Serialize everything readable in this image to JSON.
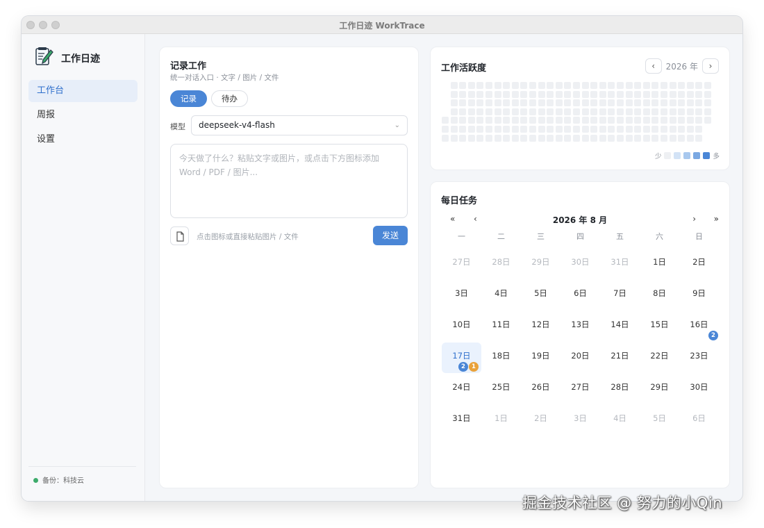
{
  "window": {
    "title": "工作日迹 WorkTrace"
  },
  "sidebar": {
    "app_name": "工作日迹",
    "items": [
      {
        "label": "工作台",
        "active": true
      },
      {
        "label": "周报",
        "active": false
      },
      {
        "label": "设置",
        "active": false
      }
    ],
    "backup_status": "备份：科技云"
  },
  "record": {
    "title": "记录工作",
    "subtitle": "统一对话入口 · 文字 / 图片 / 文件",
    "tabs": [
      {
        "label": "记录",
        "active": true
      },
      {
        "label": "待办",
        "active": false
      }
    ],
    "model_label": "模型",
    "model_value": "deepseek-v4-flash",
    "input_placeholder": "今天做了什么？粘贴文字或图片，或点击下方图标添加 Word / PDF / 图片...",
    "attach_hint": "点击图标或直接粘贴图片 / 文件",
    "send_label": "发送"
  },
  "activity": {
    "title": "工作活跃度",
    "prev": "‹",
    "next": "›",
    "year_label": "2026 年",
    "legend_less": "少",
    "legend_more": "多",
    "legend_colors": [
      "#eef0f3",
      "#d3e3f6",
      "#a8c8ee",
      "#7aa8e2",
      "#4a86d6"
    ]
  },
  "tasks": {
    "title": "每日任务",
    "nav_prev_year": "«",
    "nav_prev_month": "‹",
    "nav_next_month": "›",
    "nav_next_year": "»",
    "month_label": "2026 年 8 月",
    "weekdays": [
      "一",
      "二",
      "三",
      "四",
      "五",
      "六",
      "日"
    ],
    "days": [
      {
        "label": "27日",
        "other": true
      },
      {
        "label": "28日",
        "other": true
      },
      {
        "label": "29日",
        "other": true
      },
      {
        "label": "30日",
        "other": true
      },
      {
        "label": "31日",
        "other": true
      },
      {
        "label": "1日"
      },
      {
        "label": "2日"
      },
      {
        "label": "3日"
      },
      {
        "label": "4日"
      },
      {
        "label": "5日"
      },
      {
        "label": "6日"
      },
      {
        "label": "7日"
      },
      {
        "label": "8日"
      },
      {
        "label": "9日"
      },
      {
        "label": "10日"
      },
      {
        "label": "11日"
      },
      {
        "label": "12日"
      },
      {
        "label": "13日"
      },
      {
        "label": "14日"
      },
      {
        "label": "15日"
      },
      {
        "label": "16日",
        "badges": [
          {
            "count": "2",
            "color": "#4a86d6"
          }
        ]
      },
      {
        "label": "17日",
        "today": true,
        "badges": [
          {
            "count": "2",
            "color": "#4a86d6"
          },
          {
            "count": "1",
            "color": "#e9a23b"
          }
        ]
      },
      {
        "label": "18日"
      },
      {
        "label": "19日"
      },
      {
        "label": "20日"
      },
      {
        "label": "21日"
      },
      {
        "label": "22日"
      },
      {
        "label": "23日"
      },
      {
        "label": "24日"
      },
      {
        "label": "25日"
      },
      {
        "label": "26日"
      },
      {
        "label": "27日"
      },
      {
        "label": "28日"
      },
      {
        "label": "29日"
      },
      {
        "label": "30日"
      },
      {
        "label": "31日"
      },
      {
        "label": "1日",
        "other": true
      },
      {
        "label": "2日",
        "other": true
      },
      {
        "label": "3日",
        "other": true
      },
      {
        "label": "4日",
        "other": true
      },
      {
        "label": "5日",
        "other": true
      },
      {
        "label": "6日",
        "other": true
      }
    ]
  },
  "watermark": "掘金技术社区 @ 努力的小Qin"
}
